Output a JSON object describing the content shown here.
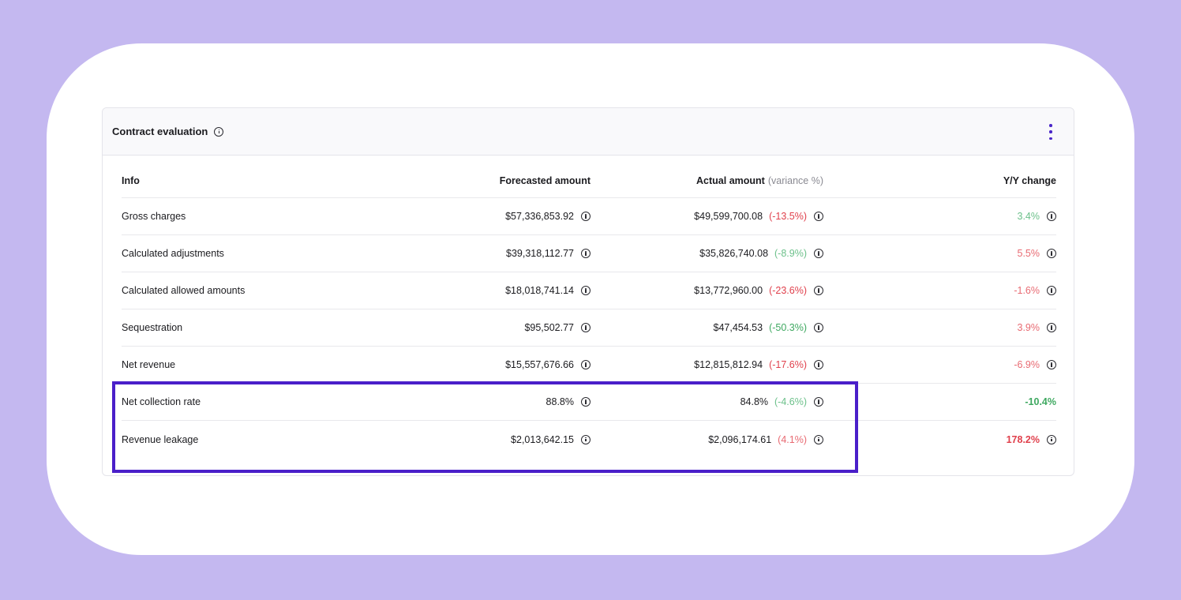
{
  "card": {
    "title": "Contract evaluation",
    "menu_icon": "kebab-vertical-icon"
  },
  "table": {
    "headers": {
      "info": "Info",
      "forecasted": "Forecasted amount",
      "actual": "Actual amount",
      "actual_suffix": "(variance %)",
      "yy": "Y/Y change"
    },
    "rows": [
      {
        "label": "Gross charges",
        "forecasted": "$57,336,853.92",
        "actual": "$49,599,700.08",
        "variance": "(-13.5%)",
        "yy": "3.4%"
      },
      {
        "label": "Calculated adjustments",
        "forecasted": "$39,318,112.77",
        "actual": "$35,826,740.08",
        "variance": "(-8.9%)",
        "yy": "5.5%"
      },
      {
        "label": "Calculated allowed amounts",
        "forecasted": "$18,018,741.14",
        "actual": "$13,772,960.00",
        "variance": "(-23.6%)",
        "yy": "-1.6%"
      },
      {
        "label": "Sequestration",
        "forecasted": "$95,502.77",
        "actual": "$47,454.53",
        "variance": "(-50.3%)",
        "yy": "3.9%"
      },
      {
        "label": "Net revenue",
        "forecasted": "$15,557,676.66",
        "actual": "$12,815,812.94",
        "variance": "(-17.6%)",
        "yy": "-6.9%"
      },
      {
        "label": "Net collection rate",
        "forecasted": "88.8%",
        "actual": "84.8%",
        "variance": "(-4.6%)",
        "yy": "-10.4%"
      },
      {
        "label": "Revenue leakage",
        "forecasted": "$2,013,642.15",
        "actual": "$2,096,174.61",
        "variance": "(4.1%)",
        "yy": "178.2%"
      }
    ]
  },
  "colors": {
    "background": "#c4b8f0",
    "highlight": "#4a1fc9",
    "negative": "#e0404c",
    "positive": "#3ea860"
  }
}
